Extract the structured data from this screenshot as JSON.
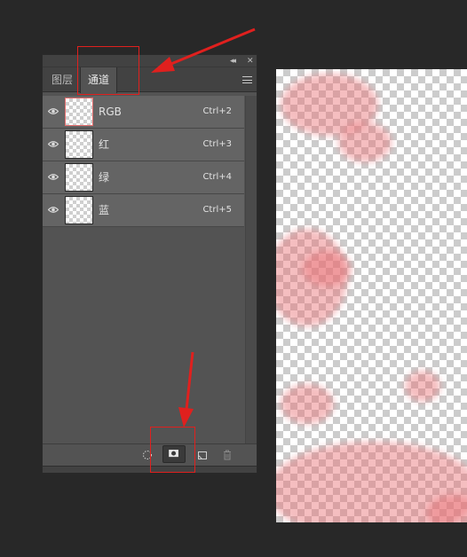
{
  "panel": {
    "collapse_glyph": "◂◂",
    "close_glyph": "✕",
    "tabs": [
      {
        "label": "图层",
        "active": false
      },
      {
        "label": "通道",
        "active": true
      }
    ],
    "channels": [
      {
        "name": "RGB",
        "shortcut": "Ctrl+2",
        "visible": true
      },
      {
        "name": "红",
        "shortcut": "Ctrl+3",
        "visible": true
      },
      {
        "name": "绿",
        "shortcut": "Ctrl+4",
        "visible": true
      },
      {
        "name": "蓝",
        "shortcut": "Ctrl+5",
        "visible": true
      }
    ],
    "footer_icons": [
      "load-selection-icon",
      "add-mask-icon",
      "new-channel-icon",
      "trash-icon"
    ]
  },
  "annotations": {
    "color": "#e0201e",
    "highlighted": [
      "tab-channels",
      "add-mask-button"
    ]
  },
  "colors": {
    "workspace": "#282828",
    "panel": "#535353",
    "row": "#646464",
    "canvas_tint": "#e86e73"
  }
}
